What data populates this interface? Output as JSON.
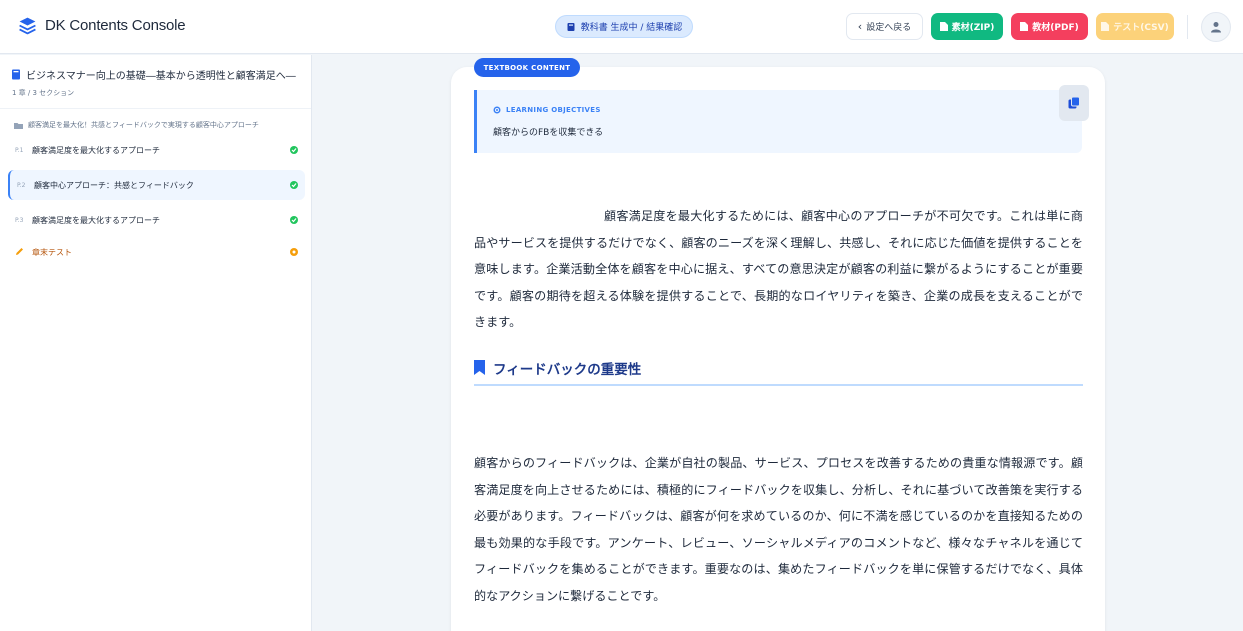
{
  "header": {
    "app_title": "DK Contents Console",
    "status": "教科書 生成中 / 結果確認",
    "back_label": "設定へ戻る",
    "zip_label": "素材(ZIP)",
    "pdf_label": "教材(PDF)",
    "csv_label": "テスト(CSV)"
  },
  "sidebar": {
    "course_title": "ビジネスマナー向上の基礎―基本から透明性と顧客満足へ―",
    "course_meta": "1 章 / 3 セクション",
    "chapter_title": "顧客満足を最大化！共感とフィードバックで実現する顧客中心アプローチ",
    "items": [
      {
        "num": "P.1",
        "label": "顧客満足度を最大化するアプローチ",
        "status": "done"
      },
      {
        "num": "P.2",
        "label": "顧客中心アプローチ：共感とフィードバック",
        "status": "done"
      },
      {
        "num": "P.3",
        "label": "顧客満足度を最大化するアプローチ",
        "status": "done"
      }
    ],
    "test_label": "章末テスト"
  },
  "content": {
    "badge": "TEXTBOOK CONTENT",
    "objectives_heading": "LEARNING OBJECTIVES",
    "objectives_text": "顧客からのFBを収集できる",
    "paragraph1": "顧客満足度を最大化するためには、顧客中心のアプローチが不可欠です。これは単に商品やサービスを提供するだけでなく、顧客のニーズを深く理解し、共感し、それに応じた価値を提供することを意味します。企業活動全体を顧客を中心に据え、すべての意思決定が顧客の利益に繋がるようにすることが重要です。顧客の期待を超える体験を提供することで、長期的なロイヤリティを築き、企業の成長を支えることができます。",
    "section_heading": "フィードバックの重要性",
    "paragraph2": "顧客からのフィードバックは、企業が自社の製品、サービス、プロセスを改善するための貴重な情報源です。顧客満足度を向上させるためには、積極的にフィードバックを収集し、分析し、それに基づいて改善策を実行する必要があります。フィードバックは、顧客が何を求めているのか、何に不満を感じているのかを直接知るための最も効果的な手段です。アンケート、レビュー、ソーシャルメディアのコメントなど、様々なチャネルを通じてフィードバックを集めることができます。重要なのは、集めたフィードバックを単に保管するだけでなく、具体的なアクションに繋げることです。"
  },
  "colors": {
    "accent": "#2563eb",
    "done": "#22c55e",
    "pending": "#f59e0b",
    "zip": "#10b981",
    "pdf": "#f43f5e",
    "csv": "#fcd27a"
  }
}
